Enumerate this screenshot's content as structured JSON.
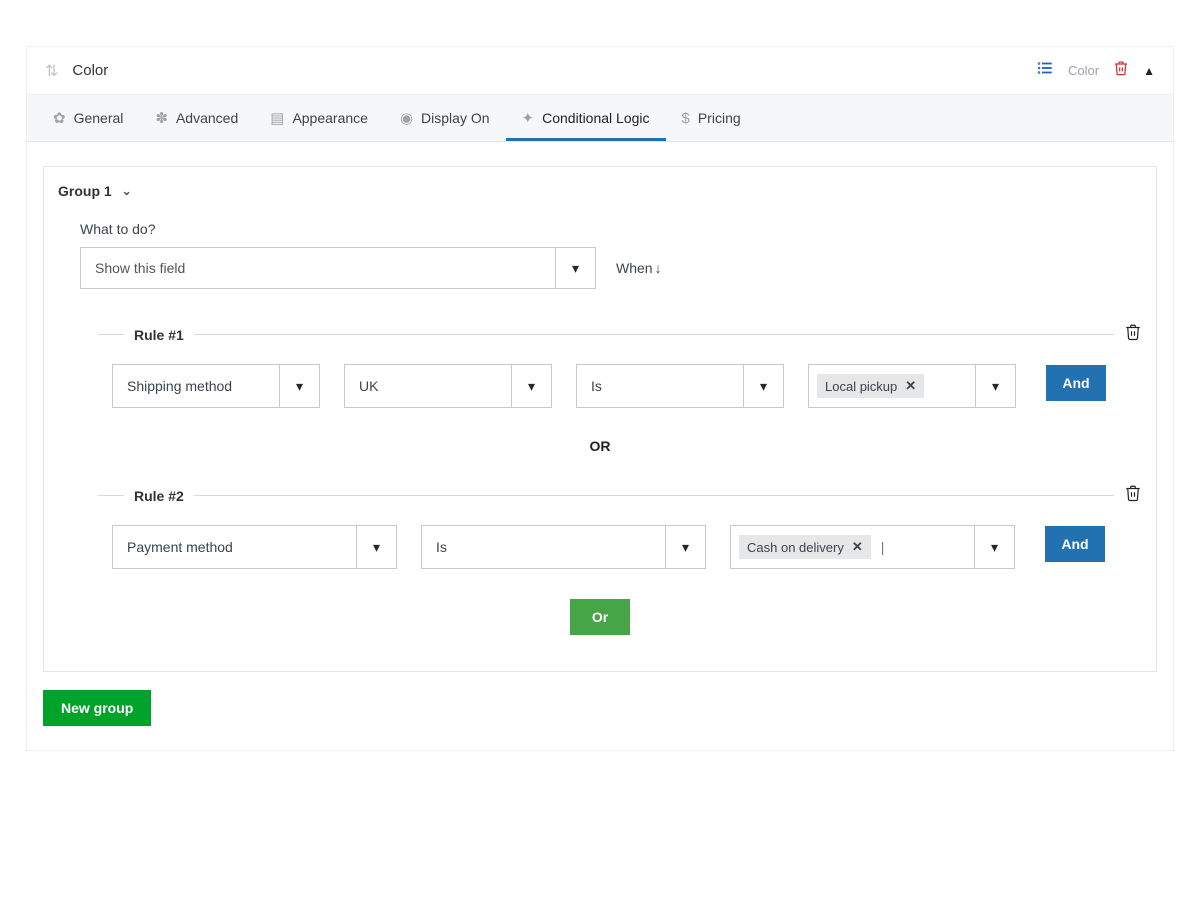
{
  "header": {
    "title": "Color",
    "sub": "Color"
  },
  "tabs": [
    {
      "label": "General"
    },
    {
      "label": "Advanced"
    },
    {
      "label": "Appearance"
    },
    {
      "label": "Display On"
    },
    {
      "label": "Conditional Logic"
    },
    {
      "label": "Pricing"
    }
  ],
  "group": {
    "title": "Group 1",
    "what_label": "What to do?",
    "action_value": "Show this field",
    "when_label": "When",
    "rules": [
      {
        "label": "Rule #1",
        "conds": [
          "Shipping method",
          "UK",
          "Is"
        ],
        "tag": "Local pickup"
      },
      {
        "label": "Rule #2",
        "conds": [
          "Payment method",
          "Is"
        ],
        "tag": "Cash on delivery"
      }
    ],
    "or_label": "OR",
    "and_btn": "And",
    "or_btn": "Or"
  },
  "new_group_btn": "New group"
}
